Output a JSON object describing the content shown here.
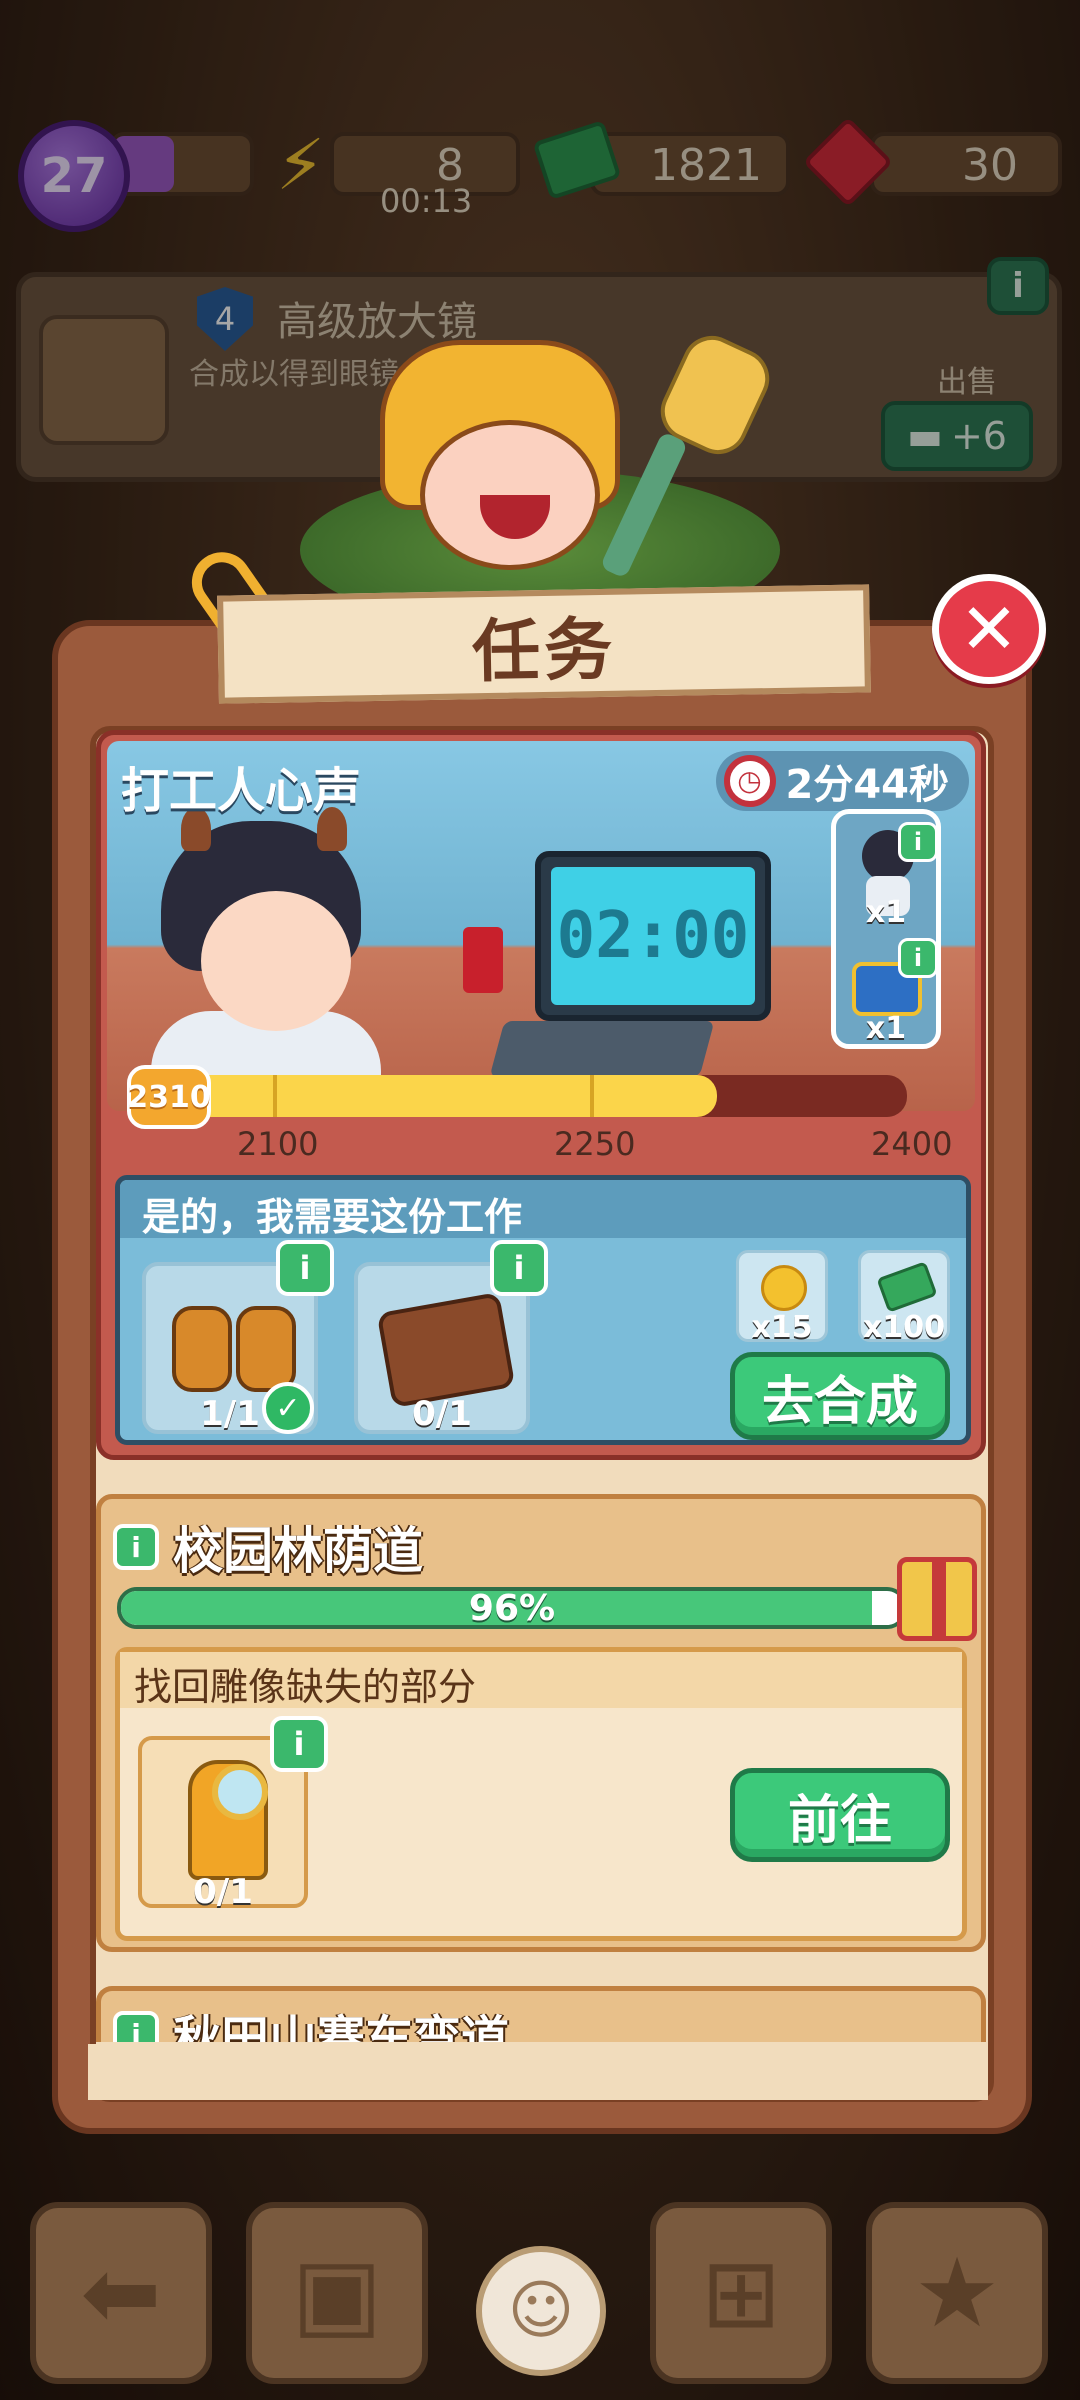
{
  "hud": {
    "level": "27",
    "energy": "8",
    "energy_timer": "00:13",
    "cash": "1821",
    "gems": "30"
  },
  "item_card": {
    "level_badge": "4",
    "name": "高级放大镜",
    "description": "合成以得到眼镜",
    "sell_label": "出售",
    "sell_value": "+6"
  },
  "dialog": {
    "title": "任务",
    "close_glyph": "✕"
  },
  "task1": {
    "name": "打工人心声",
    "timer": "2分44秒",
    "monitor_text": "02:00",
    "rewards": [
      {
        "icon": "worker-character-icon",
        "qty": "x1"
      },
      {
        "icon": "treasure-chest-icon",
        "qty": "x1"
      }
    ],
    "progress": {
      "current": "2310",
      "current_value": 2310,
      "min": 2050,
      "max": 2400,
      "ticks": [
        "2100",
        "2250",
        "2400"
      ]
    },
    "requirement": {
      "title": "是的，我需要这份工作",
      "items": [
        {
          "icon": "binoculars-icon",
          "count": "1/1",
          "done": true
        },
        {
          "icon": "leather-bag-icon",
          "count": "0/1",
          "done": false
        }
      ],
      "bonus": [
        {
          "icon": "flower-coin-icon",
          "qty": "x15"
        },
        {
          "icon": "cash-stack-icon",
          "qty": "x100"
        }
      ],
      "button": "去合成"
    }
  },
  "task2": {
    "name": "校园林荫道",
    "progress_label": "96%",
    "progress_value": 0.96,
    "requirement_title": "找回雕像缺失的部分",
    "item_count": "0/1",
    "button": "前往"
  },
  "task3": {
    "name": "秋田山赛车弯道"
  },
  "colors": {
    "accent_green": "#3cc97a",
    "close_red": "#e53b4a",
    "progress_yellow": "#fbd54a"
  }
}
